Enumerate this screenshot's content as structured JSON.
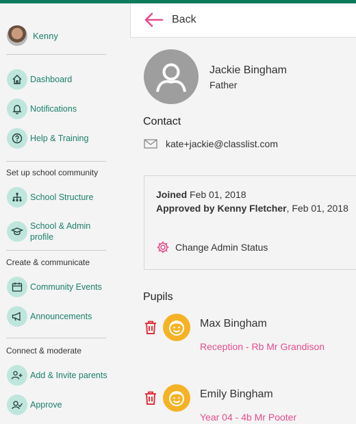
{
  "colors": {
    "accent": "#0d7a5f",
    "link": "#1a7f6a",
    "pink": "#e44d8f",
    "warning": "#f5b224",
    "delete": "#e0343c"
  },
  "sidebar": {
    "user": {
      "name": "Kenny"
    },
    "items_main": [
      {
        "label": "Dashboard",
        "icon": "home-icon"
      },
      {
        "label": "Notifications",
        "icon": "bell-icon"
      },
      {
        "label": "Help & Training",
        "icon": "help-icon"
      }
    ],
    "section_setup": {
      "heading": "Set up school community",
      "items": [
        {
          "label": "School Structure",
          "icon": "hierarchy-icon"
        },
        {
          "label_line1": "School & Admin",
          "label_line2": "profile",
          "icon": "graduation-cap-icon"
        }
      ]
    },
    "section_create": {
      "heading": "Create & communicate",
      "items": [
        {
          "label": "Community Events",
          "icon": "calendar-icon"
        },
        {
          "label": "Announcements",
          "icon": "megaphone-icon"
        }
      ]
    },
    "section_connect": {
      "heading": "Connect & moderate",
      "items": [
        {
          "label": "Add & Invite parents",
          "icon": "add-user-icon"
        },
        {
          "label": "Approve",
          "icon": "approve-icon"
        }
      ]
    }
  },
  "header": {
    "back_label": "Back"
  },
  "profile": {
    "name": "Jackie Bingham",
    "role": "Father",
    "contact_title": "Contact",
    "email": "kate+jackie@classlist.com"
  },
  "membership": {
    "joined_label": "Joined",
    "joined_date": " Feb 01, 2018",
    "approved_label": "Approved by Kenny Fletcher",
    "approved_date": ", Feb 01, 2018",
    "change_status_label": "Change Admin Status"
  },
  "pupils": {
    "title": "Pupils",
    "items": [
      {
        "name": "Max Bingham",
        "class": "Reception - Rb Mr Grandison"
      },
      {
        "name": "Emily Bingham",
        "class": "Year 04 - 4b Mr Pooter"
      }
    ]
  }
}
